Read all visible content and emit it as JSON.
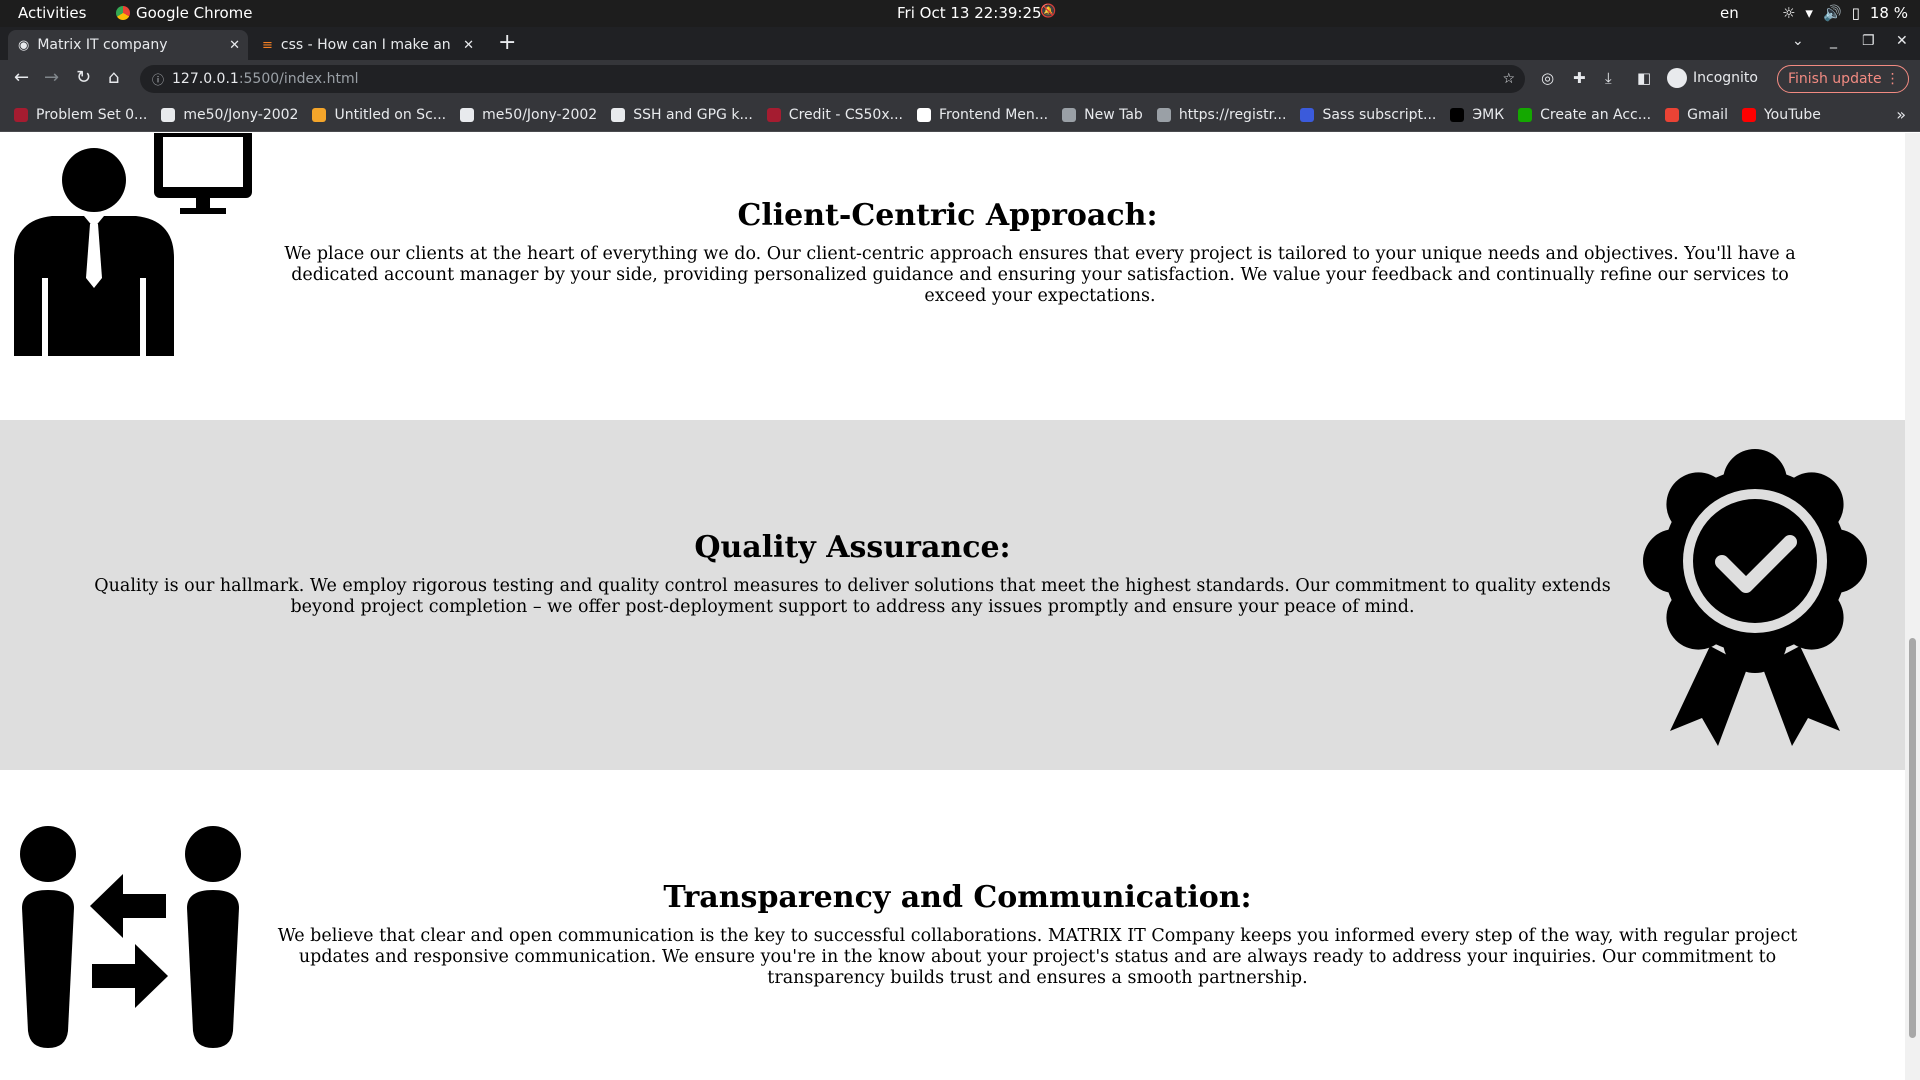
{
  "os": {
    "activities": "Activities",
    "app_name": "Google Chrome",
    "clock": "Fri Oct 13  22:39:25",
    "lang": "en",
    "battery": "18 %"
  },
  "browser": {
    "tabs": [
      {
        "title": "Matrix IT company",
        "active": true
      },
      {
        "title": "css - How can I make an SV",
        "active": false
      }
    ],
    "url_host": "127.0.0.1",
    "url_path": ":5500/index.html",
    "profile_label": "Incognito",
    "update_label": "Finish update",
    "bookmarks": [
      {
        "label": "Problem Set 0...",
        "color": "#a51c30"
      },
      {
        "label": "me50/Jony-2002",
        "color": "#e8eaed"
      },
      {
        "label": "Untitled on Sc...",
        "color": "#f4a52a"
      },
      {
        "label": "me50/Jony-2002",
        "color": "#e8eaed"
      },
      {
        "label": "SSH and GPG k...",
        "color": "#e8eaed"
      },
      {
        "label": "Credit - CS50x...",
        "color": "#a51c30"
      },
      {
        "label": "Frontend Men...",
        "color": "#ffffff"
      },
      {
        "label": "New Tab",
        "color": "#9aa0a6"
      },
      {
        "label": "https://registr...",
        "color": "#9aa0a6"
      },
      {
        "label": "Sass subscript...",
        "color": "#3b5bdb"
      },
      {
        "label": "ЭМК",
        "color": "#000000"
      },
      {
        "label": "Create an Acc...",
        "color": "#14a800"
      },
      {
        "label": "Gmail",
        "color": "#ea4335"
      },
      {
        "label": "YouTube",
        "color": "#ff0000"
      }
    ]
  },
  "page": {
    "alt_section_bg": "#dedede",
    "sections": [
      {
        "heading": "Client-Centric Approach:",
        "text": "We place our clients at the heart of everything we do. Our client-centric approach ensures that every project is tailored to your unique needs and objectives. You'll have a dedicated account manager by your side, providing personalized guidance and ensuring your satisfaction. We value your feedback and continually refine our services to exceed your expectations.",
        "icon": "client-computer-icon"
      },
      {
        "heading": "Quality Assurance:",
        "text": "Quality is our hallmark. We employ rigorous testing and quality control measures to deliver solutions that meet the highest standards. Our commitment to quality extends beyond project completion – we offer post-deployment support to address any issues promptly and ensure your peace of mind.",
        "icon": "quality-badge-icon"
      },
      {
        "heading": "Transparency and Communication:",
        "text": "We believe that clear and open communication is the key to successful collaborations. MATRIX IT Company keeps you informed every step of the way, with regular project updates and responsive communication. We ensure you're in the know about your project's status and are always ready to address your inquiries. Our commitment to transparency builds trust and ensures a smooth partnership.",
        "icon": "communication-icon"
      }
    ]
  }
}
